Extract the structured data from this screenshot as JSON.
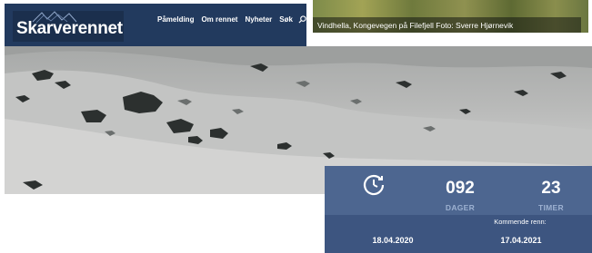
{
  "brand": {
    "logo_text": "Skarverennet"
  },
  "nav": {
    "items": [
      "Påmelding",
      "Om rennet",
      "Nyheter",
      "Søk"
    ],
    "search_icon": "search-icon"
  },
  "photo": {
    "caption": "Vindhella, Kongevegen på Filefjell Foto: Sverre Hjørnevik"
  },
  "countdown": {
    "icon": "clock-icon",
    "days_value": "092",
    "days_label": "DAGER",
    "hours_value": "23",
    "hours_label": "TIMER",
    "last_race_date": "18.04.2020",
    "next_race_label": "Kommende renn:",
    "next_race_date": "17.04.2021"
  },
  "colors": {
    "navbar": "#223a5e",
    "panel": "#3d5580",
    "label_accent": "#9db1d1"
  }
}
